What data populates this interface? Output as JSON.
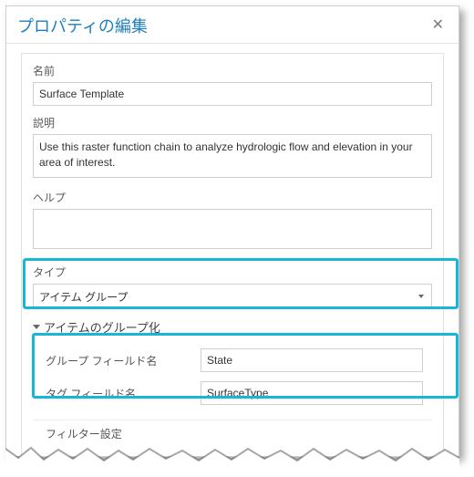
{
  "dialog": {
    "title": "プロパティの編集",
    "close_glyph": "✕"
  },
  "labels": {
    "name": "名前",
    "description": "説明",
    "help": "ヘルプ",
    "type": "タイプ",
    "grouping_section": "アイテムのグループ化",
    "group_field": "グループ フィールド名",
    "tag_field": "タグ フィールド名",
    "filter": "フィルター設定"
  },
  "values": {
    "name": "Surface Template",
    "description": "Use this raster function chain to analyze hydrologic flow and elevation in your area of interest.",
    "help": "",
    "type_selected": "アイテム グループ",
    "group_field": "State",
    "tag_field": "SurfaceType"
  }
}
